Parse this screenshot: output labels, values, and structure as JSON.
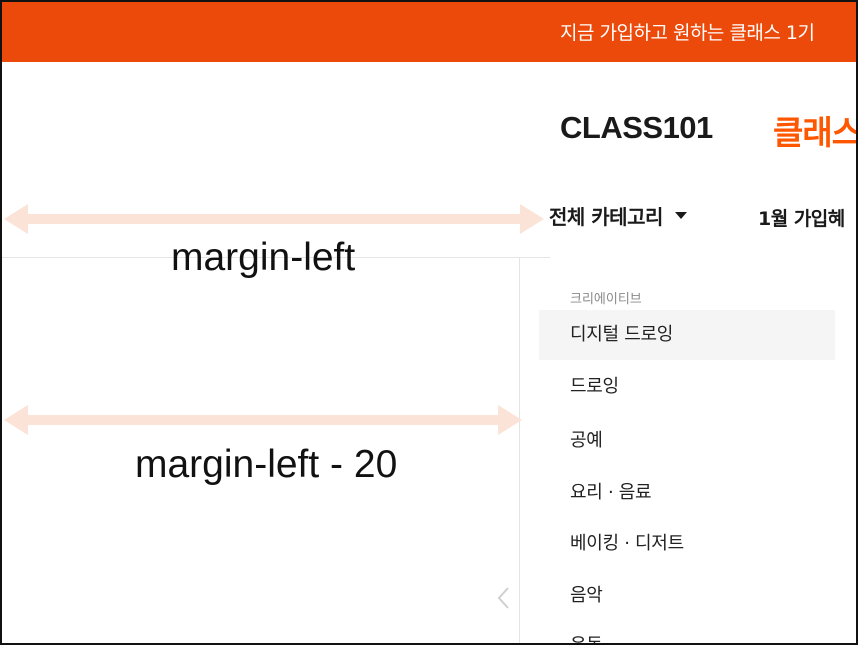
{
  "banner": {
    "text": "지금 가입하고 원하는 클래스 1기"
  },
  "header": {
    "logo": "CLASS101",
    "logo_sub": "클래스"
  },
  "nav": {
    "category_label": "전체 카테고리",
    "promo_label": "1월 가입혜"
  },
  "annotations": {
    "top": "margin-left",
    "bottom": "margin-left - 20"
  },
  "dropdown": {
    "section_header": "크리에이티브",
    "items": [
      "디지털 드로잉",
      "드로잉",
      "공예",
      "요리 · 음료",
      "베이킹 · 디저트",
      "음악",
      "운동"
    ]
  },
  "colors": {
    "brand": "#ec4a0a",
    "logo_accent": "#ff5600",
    "arrow": "#fbe3d8",
    "hover_bg": "#f5f5f5"
  },
  "icons": {
    "caret": "caret-down-icon",
    "carousel_prev": "chevron-left-icon"
  }
}
